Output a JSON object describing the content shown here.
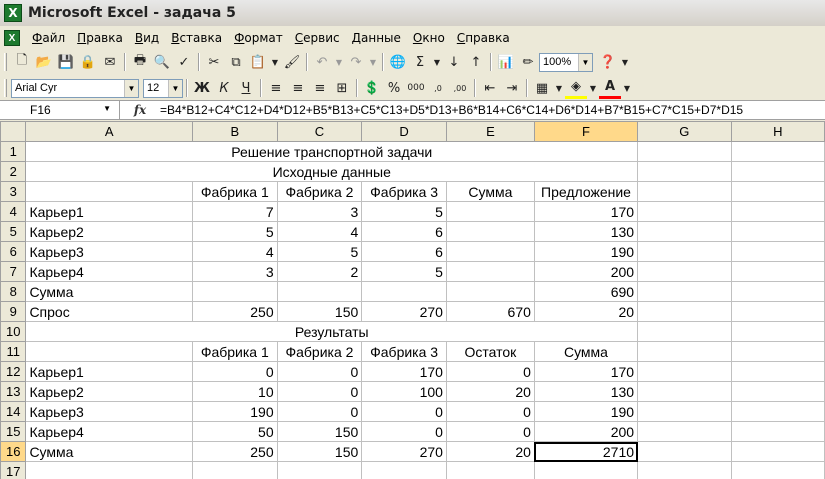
{
  "window": {
    "title": "Microsoft Excel - задача 5",
    "app_icon": "X"
  },
  "menu": [
    "Файл",
    "Правка",
    "Вид",
    "Вставка",
    "Формат",
    "Сервис",
    "Данные",
    "Окно",
    "Справка"
  ],
  "toolbar1": {
    "zoom": "100%"
  },
  "toolbar2": {
    "font_name": "Arial Cyr",
    "font_size": "12",
    "bold": "Ж",
    "italic": "К",
    "underline": "Ч"
  },
  "formula_bar": {
    "name_box": "F16",
    "fx": "fx",
    "formula": "=B4*B12+C4*C12+D4*D12+B5*B13+C5*C13+D5*D13+B6*B14+C6*C14+D6*D14+B7*B15+C7*C15+D7*D15"
  },
  "sheet": {
    "columns": [
      "A",
      "B",
      "C",
      "D",
      "E",
      "F",
      "G",
      "H"
    ],
    "active_cell": "F16",
    "rows": [
      {
        "n": "1",
        "merged": "Решение транспортной задачи"
      },
      {
        "n": "2",
        "merged": "Исходные данные"
      },
      {
        "n": "3",
        "cells": [
          "",
          "Фабрика 1",
          "Фабрика 2",
          "Фабрика 3",
          "Сумма",
          "Предложение",
          ""
        ]
      },
      {
        "n": "4",
        "cells": [
          "Карьер1",
          "7",
          "3",
          "5",
          "",
          "170",
          ""
        ]
      },
      {
        "n": "5",
        "cells": [
          "Карьер2",
          "5",
          "4",
          "6",
          "",
          "130",
          ""
        ]
      },
      {
        "n": "6",
        "cells": [
          "Карьер3",
          "4",
          "5",
          "6",
          "",
          "190",
          ""
        ]
      },
      {
        "n": "7",
        "cells": [
          "Карьер4",
          "3",
          "2",
          "5",
          "",
          "200",
          ""
        ]
      },
      {
        "n": "8",
        "cells": [
          "Сумма",
          "",
          "",
          "",
          "",
          "690",
          ""
        ]
      },
      {
        "n": "9",
        "cells": [
          "Спрос",
          "250",
          "150",
          "270",
          "670",
          "20",
          ""
        ]
      },
      {
        "n": "10",
        "merged": "Результаты"
      },
      {
        "n": "11",
        "cells": [
          "",
          "Фабрика 1",
          "Фабрика 2",
          "Фабрика 3",
          "Остаток",
          "Сумма",
          ""
        ]
      },
      {
        "n": "12",
        "cells": [
          "Карьер1",
          "0",
          "0",
          "170",
          "0",
          "170",
          ""
        ]
      },
      {
        "n": "13",
        "cells": [
          "Карьер2",
          "10",
          "0",
          "100",
          "20",
          "130",
          ""
        ]
      },
      {
        "n": "14",
        "cells": [
          "Карьер3",
          "190",
          "0",
          "0",
          "0",
          "190",
          ""
        ]
      },
      {
        "n": "15",
        "cells": [
          "Карьер4",
          "50",
          "150",
          "0",
          "0",
          "200",
          ""
        ]
      },
      {
        "n": "16",
        "cells": [
          "Сумма",
          "250",
          "150",
          "270",
          "20",
          "2710",
          ""
        ]
      },
      {
        "n": "17",
        "cells": [
          "",
          "",
          "",
          "",
          "",
          "",
          ""
        ]
      }
    ]
  }
}
